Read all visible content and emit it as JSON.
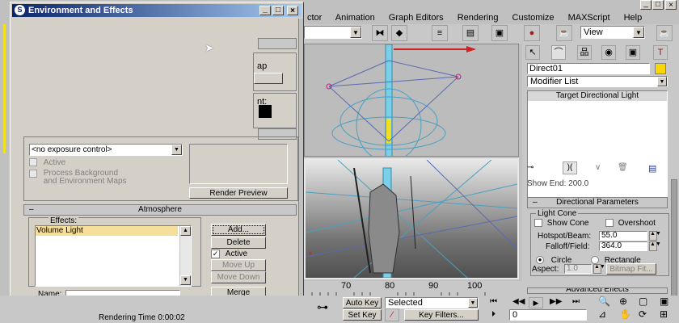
{
  "menu": {
    "items": [
      "ctor",
      "Animation",
      "Graph Editors",
      "Rendering",
      "Customize",
      "MAXScript",
      "Help"
    ]
  },
  "toolbar": {
    "view_dropdown": "View"
  },
  "dialog": {
    "title": "Environment and Effects",
    "partial_map_label": "ap",
    "partial_tint_label": "nt:",
    "exposure_dropdown": "<no exposure control>",
    "active_label": "Active",
    "process_bg_label": "Process Background\nand Environment Maps",
    "render_preview": "Render Preview",
    "atmosphere_header": "Atmosphere",
    "effects_label": "Effects:",
    "effects_items": [
      "Volume Light"
    ],
    "add_button": "Add...",
    "delete_button": "Delete",
    "active_check_label": "Active",
    "move_up": "Move Up",
    "move_down": "Move Down",
    "name_label": "Name:",
    "merge_button": "Merge"
  },
  "command_panel": {
    "object_name": "Direct01",
    "object_color": "#f8d800",
    "modifier_list": "Modifier List",
    "stack_item": "Target Directional Light",
    "partial_row": "Show    End: 200.0",
    "directional_header": "Directional Parameters",
    "light_cone_group": "Light Cone",
    "show_cone": "Show Cone",
    "overshoot": "Overshoot",
    "hotspot_label": "Hotspot/Beam:",
    "hotspot_value": "55.0",
    "falloff_label": "Falloff/Field:",
    "falloff_value": "364.0",
    "circle": "Circle",
    "rectangle": "Rectangle",
    "aspect_label": "Aspect:",
    "aspect_value": "1.0",
    "bitmap_fit": "Bitmap Fit...",
    "partial_effects": "Advanced Effects"
  },
  "timeline": {
    "ticks": [
      "70",
      "80",
      "90",
      "100"
    ]
  },
  "bottom": {
    "auto_key": "Auto Key",
    "set_key": "Set Key",
    "selected_dropdown": "Selected",
    "key_filters": "Key Filters...",
    "frame_value": "0",
    "rendering_time": "Rendering Time  0:00:02"
  }
}
